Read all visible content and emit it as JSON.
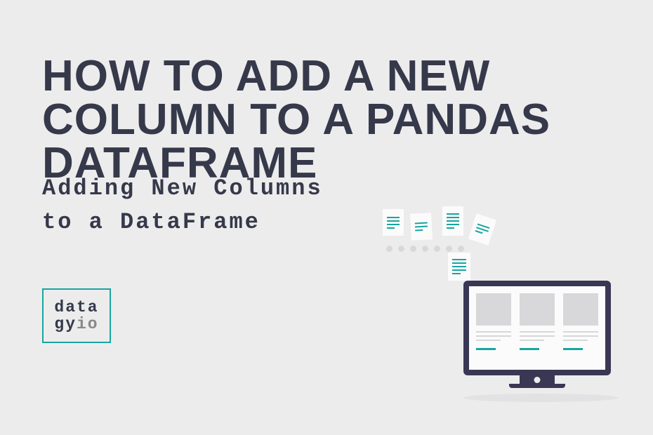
{
  "title": "How to Add a New Column to a Pandas DataFrame",
  "subtitle_line1": "Adding New Columns",
  "subtitle_line2": "to a DataFrame",
  "logo": {
    "line1": "data",
    "line2_a": "gy",
    "line2_b": "io"
  }
}
